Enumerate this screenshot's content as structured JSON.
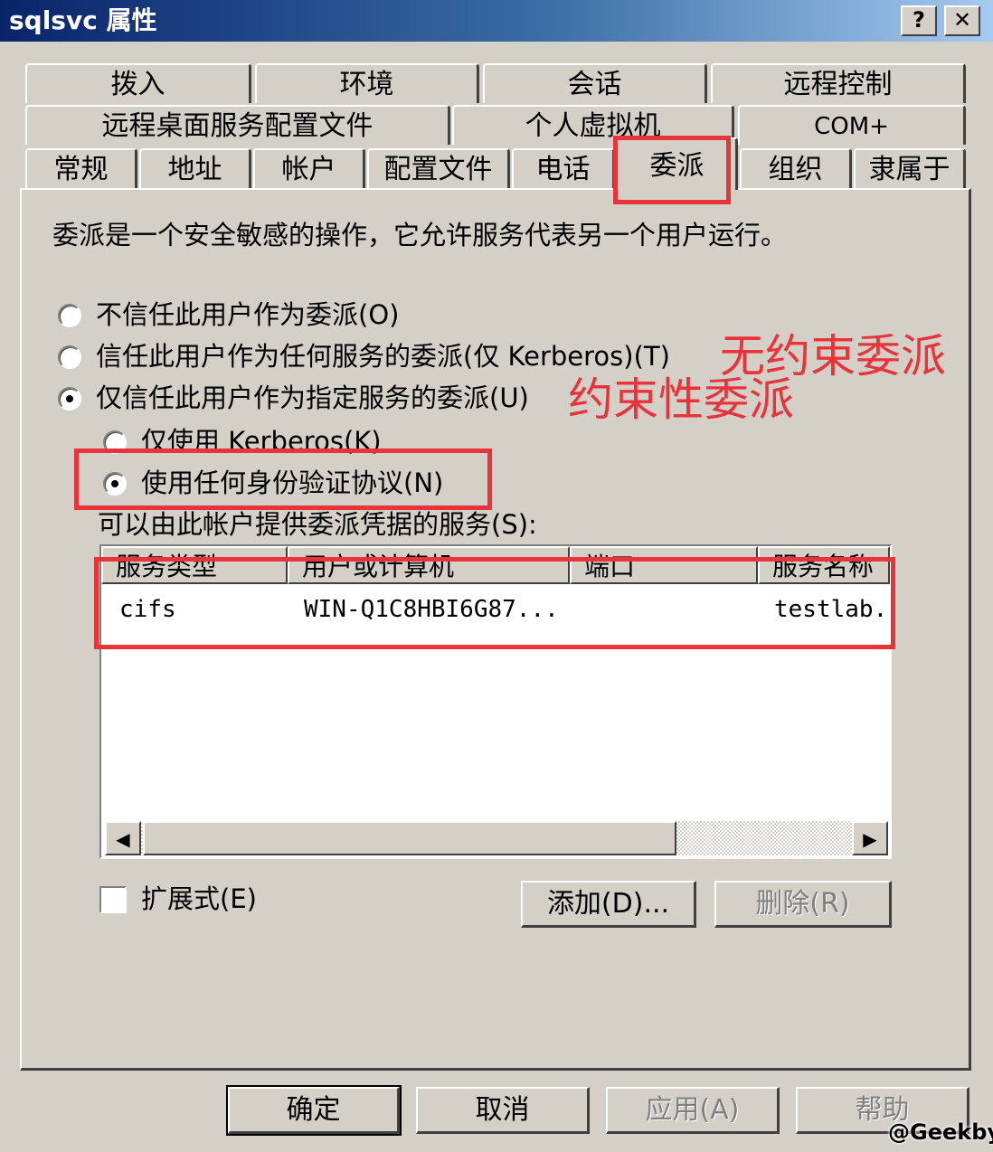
{
  "window": {
    "title": "sqlsvc 属性",
    "help_button": "?",
    "close_button": "✕"
  },
  "tabs": {
    "row1": [
      "拨入",
      "环境",
      "会话",
      "远程控制"
    ],
    "row2": [
      "远程桌面服务配置文件",
      "个人虚拟机",
      "COM+"
    ],
    "row3": [
      "常规",
      "地址",
      "帐户",
      "配置文件",
      "电话",
      "委派",
      "组织",
      "隶属于"
    ],
    "active": "委派"
  },
  "delegation": {
    "description": "委派是一个安全敏感的操作，它允许服务代表另一个用户运行。",
    "options": [
      {
        "label": "不信任此用户作为委派(O)",
        "selected": false
      },
      {
        "label": "信任此用户作为任何服务的委派(仅 Kerberos)(T)",
        "selected": false
      },
      {
        "label": "仅信任此用户作为指定服务的委派(U)",
        "selected": true
      }
    ],
    "sub_options": [
      {
        "label": "仅使用 Kerberos(K)",
        "selected": false
      },
      {
        "label": "使用任何身份验证协议(N)",
        "selected": true
      }
    ],
    "services_label": "可以由此帐户提供委派凭据的服务(S):",
    "columns": [
      "服务类型",
      "用户或计算机",
      "端口",
      "服务名称"
    ],
    "rows": [
      {
        "service_type": "cifs",
        "user_or_computer": "WIN-Q1C8HBI6G87...",
        "port": "",
        "service_name": "testlab."
      }
    ],
    "expanded_label": "扩展式(E)",
    "expanded_checked": false,
    "add_button": "添加(D)...",
    "remove_button": "删除(R)"
  },
  "annotations": {
    "unconstrained": "无约束委派",
    "constrained": "约束性委派",
    "color": "#e8333a"
  },
  "footer": {
    "ok": "确定",
    "cancel": "取消",
    "apply": "应用(A)",
    "help": "帮助"
  },
  "watermark": "@Geekby",
  "scrollbar": {
    "left_arrow": "◀",
    "right_arrow": "▶"
  }
}
